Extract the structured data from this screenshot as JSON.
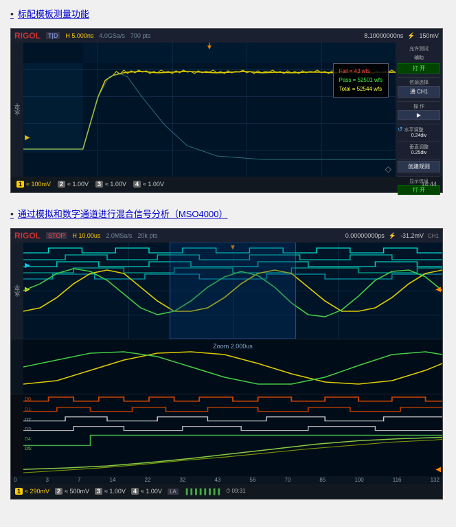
{
  "section1": {
    "bullet": "•",
    "link_text": "标配模板测量功能"
  },
  "osc1": {
    "brand": "RIGOL",
    "mode": "T|D",
    "timebase": "H  5.000ns",
    "samplerate": "4.0GSa/s",
    "samplerate_sub": "700 pts",
    "time_offset": "8.10000000ns",
    "trigger_icon": "⚡",
    "voltage": "150mV",
    "popup": {
      "fail": "Fail = 43 wfs",
      "pass": "Pass = 52501 wfs",
      "total": "Total = 52544 wfs"
    },
    "right_panel": {
      "test_label": "允许测试",
      "assist_label": "辅助",
      "open1": "打 开",
      "source_label": "信源选择",
      "ch_label": "通 CH1",
      "operate_label": "操 作",
      "play_btn": "▶",
      "h_adjust_label": "水平调整",
      "h_adjust_val": "0.24div",
      "v_adjust_label": "垂直调整",
      "v_adjust_val": "0.25div",
      "rule_label": "创建规则",
      "info_label": "显示信息",
      "open2": "打 开"
    },
    "channels": [
      {
        "num": "1",
        "color": "yellow",
        "val": "≈ 100mV"
      },
      {
        "num": "2",
        "color": "grey",
        "val": "≈ 1.00V"
      },
      {
        "num": "3",
        "color": "grey",
        "val": "≈ 1.00V"
      },
      {
        "num": "4",
        "color": "grey",
        "val": "≈ 1.00V"
      }
    ],
    "time": "14:44"
  },
  "section2": {
    "bullet": "•",
    "link_text": "通过模拟和数字通道进行混合信号分析（MSO4000）"
  },
  "osc2": {
    "brand": "RIGOL",
    "mode": "STOP",
    "timebase": "H  10.00us",
    "samplerate": "2.0MSa/s",
    "samplerate_sub": "20k pts",
    "time_offset": "0.00000000ps",
    "voltage": "-31.2mV",
    "zoom_label": "Zoom 2.000us",
    "time_axis": [
      "0",
      "3",
      "7",
      "14",
      "22",
      "32",
      "43",
      "56",
      "70",
      "85",
      "100",
      "116",
      "132"
    ],
    "digital_ch_labels": [
      "D0:",
      "D1:",
      "D2:",
      "D3:",
      "D4:",
      "D5:"
    ],
    "channels": [
      {
        "num": "1",
        "color": "yellow",
        "val": "≈ 290mV"
      },
      {
        "num": "2",
        "color": "grey",
        "val": "≈ 500mV"
      },
      {
        "num": "3",
        "color": "grey",
        "val": "≈ 1.00V"
      },
      {
        "num": "4",
        "color": "grey",
        "val": "≈ 1.00V"
      }
    ],
    "la_label": "LA",
    "time": "09:31",
    "ch1_label": "CH1"
  }
}
